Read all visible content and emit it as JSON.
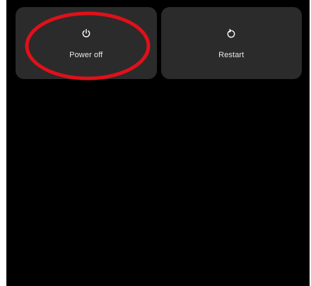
{
  "power_menu": {
    "items": [
      {
        "label": "Power off",
        "icon": "power-icon"
      },
      {
        "label": "Restart",
        "icon": "restart-icon"
      }
    ]
  },
  "colors": {
    "background": "#000000",
    "tile": "#2b2b2b",
    "text": "#e8e8e8",
    "annotation": "#e0101a"
  }
}
